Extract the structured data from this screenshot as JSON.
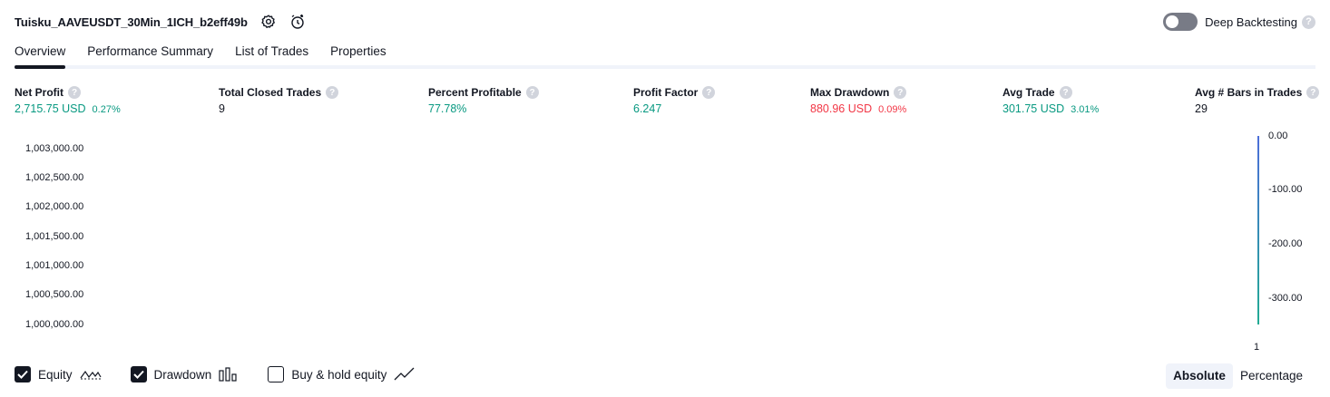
{
  "header": {
    "strategy_name": "Tuisku_AAVEUSDT_30Min_1ICH_b2eff49b"
  },
  "deep_backtesting": {
    "label": "Deep Backtesting",
    "enabled": false,
    "help": "?"
  },
  "tabs": [
    {
      "label": "Overview",
      "active": true
    },
    {
      "label": "Performance Summary",
      "active": false
    },
    {
      "label": "List of Trades",
      "active": false
    },
    {
      "label": "Properties",
      "active": false
    }
  ],
  "metrics": {
    "net_profit": {
      "label": "Net Profit",
      "value": "2,715.75 USD",
      "pct": "0.27%"
    },
    "total_closed_trades": {
      "label": "Total Closed Trades",
      "value": "9"
    },
    "percent_profitable": {
      "label": "Percent Profitable",
      "value": "77.78%"
    },
    "profit_factor": {
      "label": "Profit Factor",
      "value": "6.247"
    },
    "max_drawdown": {
      "label": "Max Drawdown",
      "value": "880.96 USD",
      "pct": "0.09%"
    },
    "avg_trade": {
      "label": "Avg Trade",
      "value": "301.75 USD",
      "pct": "3.01%"
    },
    "avg_bars": {
      "label": "Avg # Bars in Trades",
      "value": "29"
    }
  },
  "chart_data": {
    "type": "line",
    "left_axis_ticks": [
      "1,003,000.00",
      "1,002,500.00",
      "1,002,000.00",
      "1,001,500.00",
      "1,001,000.00",
      "1,000,500.00",
      "1,000,000.00"
    ],
    "right_axis_ticks": [
      "0.00",
      "-100.00",
      "-200.00",
      "-300.00"
    ],
    "x_ticks": [
      "1"
    ],
    "ylim_left": [
      1000000,
      1003000
    ],
    "ylim_right": [
      -350,
      0
    ]
  },
  "footer": {
    "equity": {
      "label": "Equity",
      "checked": true,
      "icon": "equity-line-icon"
    },
    "drawdown": {
      "label": "Drawdown",
      "checked": true,
      "icon": "drawdown-bars-icon"
    },
    "buy_hold": {
      "label": "Buy & hold equity",
      "checked": false,
      "icon": "buy-hold-line-icon"
    }
  },
  "view_mode": {
    "absolute": "Absolute",
    "percentage": "Percentage",
    "selected": "Absolute"
  },
  "colors": {
    "profit": "#089981",
    "loss": "#f23645",
    "text": "#131722",
    "accent_blue": "#4c6ed9"
  }
}
